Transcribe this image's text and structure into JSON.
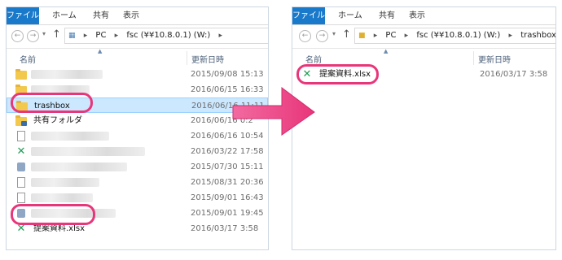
{
  "ribbon_tabs": [
    "ファイル",
    "ホーム",
    "共有",
    "表示"
  ],
  "nav": {
    "back_icon": "back-arrow-icon",
    "forward_icon": "forward-arrow-icon",
    "dropdown_icon": "chevron-down-icon",
    "up_icon": "up-arrow-icon"
  },
  "left": {
    "breadcrumb": [
      "PC",
      "fsc (¥¥10.8.0.1) (W:)"
    ],
    "columns": {
      "name": "名前",
      "date": "更新日時"
    },
    "rows": [
      {
        "icon": "folder-icon",
        "name": "",
        "date": "2015/09/08 15:13",
        "selected": false,
        "blurred": true
      },
      {
        "icon": "folder-icon",
        "name": "",
        "date": "2016/06/15 16:33",
        "selected": false,
        "blurred": true
      },
      {
        "icon": "folder-icon",
        "name": "trashbox",
        "date": "2016/06/16 11:11",
        "selected": true,
        "blurred": false
      },
      {
        "icon": "shared-folder-icon",
        "name": "共有フォルダ",
        "date": "2016/06/16 0:2",
        "selected": false,
        "blurred": false
      },
      {
        "icon": "document-icon",
        "name": "",
        "date": "2016/06/16 10:54",
        "selected": false,
        "blurred": true
      },
      {
        "icon": "excel-icon",
        "name": "",
        "date": "2016/03/22 17:58",
        "selected": false,
        "blurred": true
      },
      {
        "icon": "app-icon",
        "name": "",
        "date": "2015/07/30 15:11",
        "selected": false,
        "blurred": true
      },
      {
        "icon": "document-icon",
        "name": "",
        "date": "2015/08/31 20:36",
        "selected": false,
        "blurred": true
      },
      {
        "icon": "document-icon",
        "name": "",
        "date": "2015/09/01 16:43",
        "selected": false,
        "blurred": true
      },
      {
        "icon": "app-icon",
        "name": "",
        "date": "2015/09/01 19:45",
        "selected": false,
        "blurred": true
      },
      {
        "icon": "excel-icon",
        "name": "提案資料.xlsx",
        "date": "2016/03/17 3:58",
        "selected": false,
        "blurred": false
      }
    ]
  },
  "right": {
    "breadcrumb": [
      "PC",
      "fsc (¥¥10.8.0.1) (W:)",
      "trashbox"
    ],
    "columns": {
      "name": "名前",
      "date": "更新日時"
    },
    "rows": [
      {
        "icon": "excel-icon",
        "name": "提案資料.xlsx",
        "date": "2016/03/17 3:58",
        "selected": false,
        "blurred": false
      }
    ]
  },
  "colors": {
    "ribbon_file_tab": "#1979ca",
    "selection_fill": "#cce8ff",
    "highlight_pink": "#e8367a",
    "folder_yellow": "#f2c94c",
    "excel_green": "#1f9d55"
  }
}
